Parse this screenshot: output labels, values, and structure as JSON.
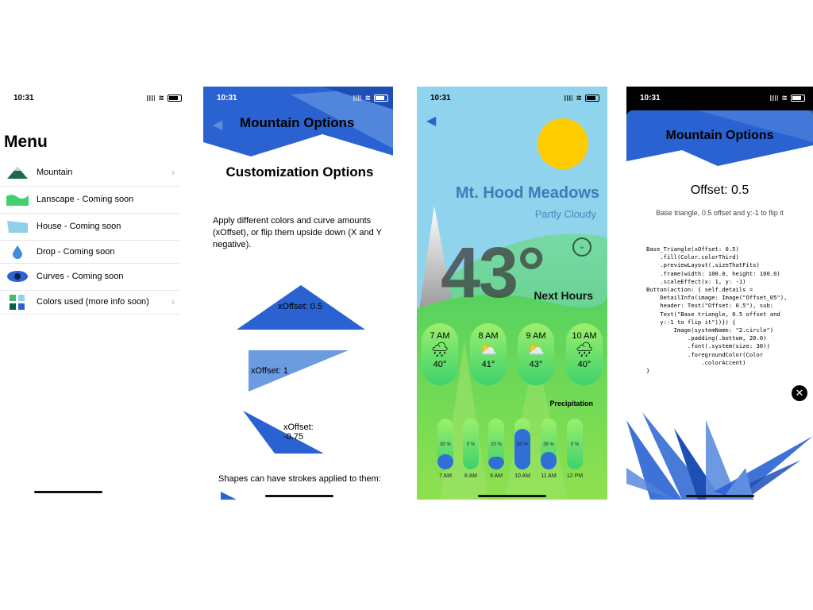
{
  "status": {
    "time": "10:31"
  },
  "menu": {
    "title": "Menu",
    "items": [
      {
        "label": "Mountain",
        "icon": "mountain-icon"
      },
      {
        "label": "Lanscape - Coming soon",
        "icon": "landscape-icon"
      },
      {
        "label": "House - Coming soon",
        "icon": "house-icon"
      },
      {
        "label": "Drop - Coming soon",
        "icon": "drop-icon"
      },
      {
        "label": "Curves - Coming soon",
        "icon": "eye-icon"
      },
      {
        "label": "Colors used (more info soon)",
        "icon": "color-grid-icon"
      }
    ]
  },
  "options": {
    "header_title": "Mountain Options",
    "subtitle": "Customization Options",
    "description": "Apply different colors and curve amounts (xOffset), or flip them upside down (X and Y negative).",
    "shapes": [
      "xOffset: 0.5",
      "xOffset: 1",
      "xOffset: -0.75"
    ],
    "strokes_text": "Shapes can have strokes applied to them:"
  },
  "weather": {
    "location": "Mt. Hood Meadows",
    "condition": "Partly Cloudy",
    "temperature": "43°",
    "next_hours_label": "Next Hours",
    "hours": [
      {
        "time": "7 AM",
        "icon": "rain-icon",
        "temp": "40°"
      },
      {
        "time": "8 AM",
        "icon": "partly-sunny-icon",
        "temp": "41°"
      },
      {
        "time": "9 AM",
        "icon": "partly-sunny-icon",
        "temp": "43°"
      },
      {
        "time": "10 AM",
        "icon": "rain-icon",
        "temp": "40°"
      }
    ],
    "precipitation_label": "Precipitation",
    "precip": [
      {
        "time": "7 AM",
        "pct": "30 %",
        "value": 0.3
      },
      {
        "time": "8 AM",
        "pct": "0 %",
        "value": 0.0
      },
      {
        "time": "9 AM",
        "pct": "20 %",
        "value": 0.2
      },
      {
        "time": "10 AM",
        "pct": "80 %",
        "value": 0.8
      },
      {
        "time": "11 AM",
        "pct": "35 %",
        "value": 0.35
      },
      {
        "time": "12 PM",
        "pct": "0 %",
        "value": 0.0
      }
    ]
  },
  "detail": {
    "header_title": "Mountain Options",
    "offset_title": "Offset: 0.5",
    "description": "Base triangle, 0.5 offset and y:-1 to flip it",
    "code": "Base_Triangle(xOffset: 0.5)\n    .fill(Color.colorThird)\n    .previewLayout(.sizeThatFits)\n    .frame(width: 100.0, height: 100.0)\n    .scaleEffect(x: 1, y: -1)\nButton(action: { self.details =\n    DetailInfo(image: Image(\"Offset_05\"),\n    header: Text(\"Offset: 0.5\"), sub:\n    Text(\"Base triangle, 0.5 offset and\n    y:-1 to flip it\"))}) {\n        Image(systemName: \"2.circle\")\n            .padding(.bottom, 20.0)\n            .font(.system(size: 30))\n            .foregroundColor(Color\n                .colorAccent)\n}"
  },
  "colors": {
    "accent": "#2a63d1",
    "green": "#3fd16d",
    "sky": "#8fd3ec",
    "sun": "#ffcc00"
  }
}
